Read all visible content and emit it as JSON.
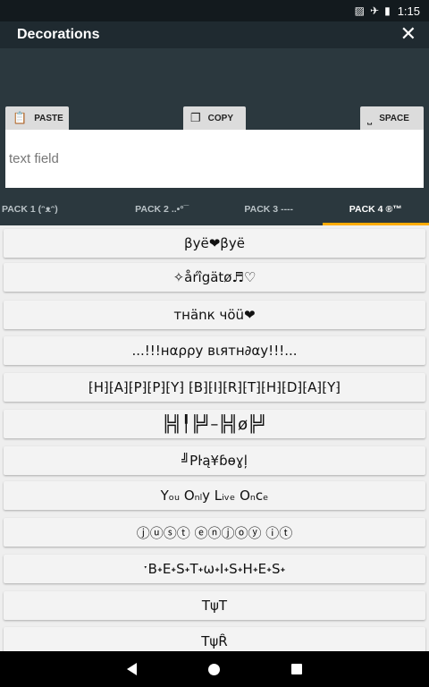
{
  "status_bar": {
    "time": "1:15",
    "icons": [
      "no-sim-icon",
      "airplane-icon",
      "battery-icon"
    ]
  },
  "toolbar": {
    "title": "Decorations",
    "close_icon": "close-icon"
  },
  "actions": {
    "paste_label": "PASTE",
    "copy_label": "COPY",
    "space_label": "SPACE"
  },
  "text_field": {
    "placeholder": "text field",
    "value": ""
  },
  "tabs": [
    {
      "label": "PACK 1 (ᵔᴥᵔ)",
      "active": false
    },
    {
      "label": "PACK 2 ..•°¯",
      "active": false
    },
    {
      "label": "PACK 3 ----",
      "active": false
    },
    {
      "label": "PACK 4 ®™",
      "active": true
    }
  ],
  "items": [
    "βyë❤βyë",
    "✧åŕîgätø♬♡",
    "тнänк чöü❤",
    "...!!!нαρρу вιятн∂αу!!!...",
    "⁅H⁆⁅A⁆⁅P⁆⁅P⁆⁅Y⁆ ⁅B⁆⁅I⁆⁅R⁆⁅T⁆⁅H⁆⁅D⁆⁅A⁆⁅Y⁆",
    "╠╣╿╠╝–╠╣ø╠╝",
    "╝Pŀą¥ɓѳɣļ",
    "Yₒᵤ Oₙₗy Lᵢᵥₑ Oₙcₑ",
    "ⓙⓤⓢⓣ ⓔⓝⓙⓞⓨ ⓘⓣ",
    "ˑB˖E˖S˖T˖ω˖I˖S˖H˖E˖S˖",
    "ΤψΤ",
    "ΤψȒ"
  ],
  "colors": {
    "accent": "#ffab00",
    "header": "#2b383e",
    "toolbar": "#1f2a30",
    "status_bar": "#131a1e"
  }
}
